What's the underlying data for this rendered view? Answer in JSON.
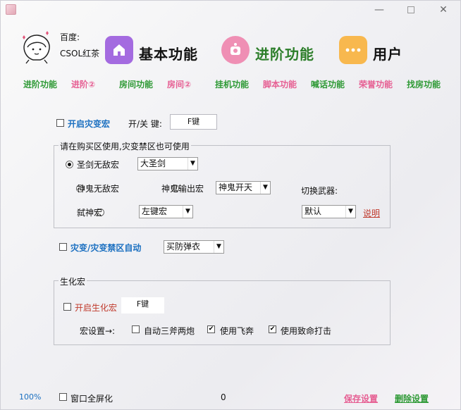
{
  "header": {
    "baidu_label": "百度:",
    "user_name": "CSOL红茶",
    "tabs": [
      {
        "label": "基本功能",
        "icon": "home-icon"
      },
      {
        "label": "进阶功能",
        "icon": "record-icon"
      },
      {
        "label": "用户",
        "icon": "more-dots-icon"
      }
    ]
  },
  "nav_links": [
    {
      "label": "进阶功能"
    },
    {
      "label": "进阶②"
    },
    {
      "label": "房间功能"
    },
    {
      "label": "房间②"
    },
    {
      "label": "挂机功能"
    },
    {
      "label": "脚本功能"
    },
    {
      "label": "喊话功能"
    },
    {
      "label": "荣誉功能"
    },
    {
      "label": "找房功能"
    }
  ],
  "disaster_macro": {
    "enable_label": "开启灾变宏",
    "toggle_label": "开/关 键:",
    "key_value": "F键"
  },
  "purchase_group": {
    "title": "请在购买区使用,灾变禁区也可使用",
    "option1_label": "圣剑无敌宏",
    "option1_select": "大圣剑",
    "option2_label": "神鬼无敌宏",
    "option3_label": "神鬼输出宏",
    "option3_select": "神鬼开天",
    "switch_weapon_label": "切换武器:",
    "option4_label": "弑神宏",
    "option4_select": "左键宏",
    "weapon_select": "默认",
    "help_link": "说明"
  },
  "auto_zone": {
    "label": "灾变/灾变禁区自动",
    "select": "买防弹衣"
  },
  "bio_group": {
    "title": "生化宏",
    "enable_label": "开启生化宏",
    "key_value": "F键",
    "settings_label": "宏设置→:",
    "opt_auto_label": "自动三斧两炮",
    "opt_fly_label": "使用飞奔",
    "opt_crit_label": "使用致命打击"
  },
  "footer": {
    "zoom": "100%",
    "fullscreen_label": "窗口全屏化",
    "counter": "0",
    "save_label": "保存设置",
    "delete_label": "删除设置"
  },
  "colors": {
    "accent_green": "#2f9a36",
    "accent_pink": "#e65f93",
    "tile_purple": "#a46be0",
    "tile_pink": "#ef8fb4",
    "tile_orange": "#f8b84e"
  }
}
